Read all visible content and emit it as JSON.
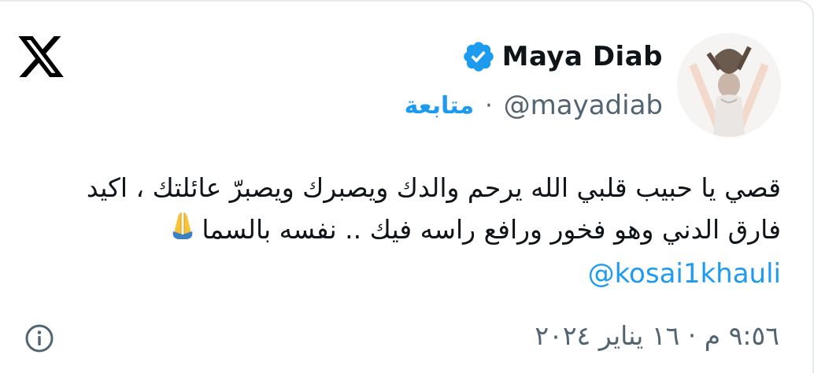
{
  "profile": {
    "display_name": "Maya Diab",
    "handle": "@mayadiab",
    "follow_label": "متابعة",
    "separator": "·",
    "verified": true,
    "verified_color": "#1d9bf0"
  },
  "tweet": {
    "lines": [
      "قصي يا حبيب قلبي الله يرحم والدك ويصبرك ويصبرّ عائلتك ، اكيد",
      "فارق الدني وهو فخور  ورافع راسه فيك .. نفسه بالسما"
    ],
    "emoji": "folded-hands",
    "mention": "@kosai1khauli",
    "timestamp": "٩:٥٦ م · ١٦ يناير ٢٠٢٤"
  },
  "icons": {
    "brand": "x-logo-icon",
    "verified": "verified-badge-icon",
    "info": "info-icon"
  },
  "colors": {
    "link": "#1d9bf0",
    "secondary_text": "#536471",
    "primary_text": "#0f1419"
  }
}
